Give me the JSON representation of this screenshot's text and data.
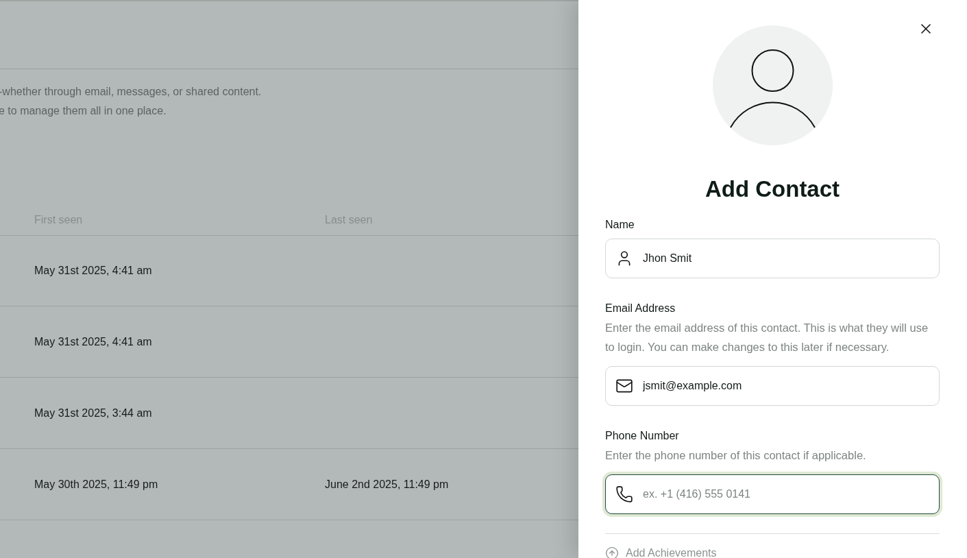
{
  "background": {
    "description": [
      "-whether through email, messages, or shared content.",
      "e to manage them all in one place."
    ],
    "table": {
      "columns": [
        "First seen",
        "Last seen"
      ],
      "rows": [
        {
          "first_seen": "May 31st 2025, 4:41 am"
        },
        {
          "first_seen": "May 31st 2025, 4:41 am"
        },
        {
          "first_seen": "May 31st 2025, 3:44 am"
        },
        {
          "first_seen": "May 30th 2025, 11:49 pm",
          "last_seen": "June 2nd 2025, 11:49 pm"
        }
      ]
    }
  },
  "panel": {
    "title": "Add Contact",
    "fields": [
      {
        "kind": "name",
        "label": "Name",
        "value": "Jhon Smit",
        "focused": false
      },
      {
        "kind": "email",
        "label": "Email Address",
        "hint": "Enter the email address of this contact. This is what they will use to login. You can make changes to this later if necessary.",
        "value": "jsmit@example.com",
        "focused": false
      },
      {
        "kind": "phone",
        "label": "Phone Number",
        "hint": "Enter the phone number of this contact if applicable.",
        "placeholder": "ex. +1 (416) 555 0141",
        "focused": true
      }
    ],
    "add_link": "Add Achievements"
  }
}
